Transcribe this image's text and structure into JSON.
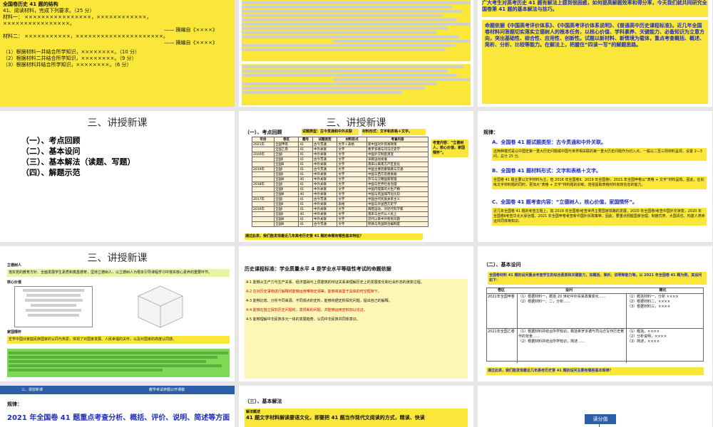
{
  "slides": {
    "s1": {
      "lines": [
        "全国卷历史 41 题的结构",
        "41、阅读材料，完成下列要求。（25 分）",
        "材料一：  ××××××××××××××××，××××××××××××，",
        "××××××××××××××××。",
        "—— 摘编自《××××》",
        "材料二：  ×××××××××××，×××××××××××××××××××××。",
        "—— 摘编自《××××》"
      ],
      "questions": [
        "（1）根据材料一并结合所学知识，××××××××。（10 分）",
        "（2）根据材料二并结合所学知识，××××××××。（9 分）",
        "（3）根据材料并结合所学知识，××××××××。（6 分）"
      ]
    },
    "s3": {
      "intro": "广大考生对高考历史 41 题有解法上感到很困惑，如何提高解题效率和得分率，今天我们就共同研究全国卷第 41 题的基本解法与技巧。",
      "body": "命题依据《中国高考评价体系》、《中国高考评价体系说明》、《普通高中历史课程标准》。近几年全国卷材料问答题切实落实立德树人的根本任务，以核心价值、学科素养、关键能力、必备知识为立意方向，突出基础性、综合性、应用性、创新性。试题以新材料、新情境为载体，重点考查概括、概述、简析、分析、比较等能力。在解法上，把握住“四读一写”的解题思路。"
    },
    "s4": {
      "title": "三、讲授新课",
      "items": [
        "（一）、考点回顾",
        "（二）、基本设问",
        "（三）、基本解法（读题、写题）",
        "（四）、解题示范"
      ]
    },
    "s5": {
      "title": "三、讲授新课",
      "heading": "（一）、考点回顾",
      "tag1": "试题类型：古今贯通和中外关联",
      "tag2": "材料形式：文字和表格＋文字。",
      "side": "考查内容：“立德树人，核心价值，家国情怀”。",
      "headers": [
        "年份",
        "卷区",
        "题号",
        "试题类型",
        "材料形式",
        "考查内容"
      ],
      "rows": [
        [
          "2021年",
          "全国甲卷",
          "41",
          "古今贯通",
          "文字＋表格",
          "新中国对外贸易政策"
        ],
        [
          "",
          "全国乙卷",
          "41",
          "中外关联",
          "文字",
          "希罗多德与司马迁史学"
        ],
        [
          "2020年",
          "全国Ⅰ",
          "41",
          "中外关联",
          "文字",
          "中国外交制度演变"
        ],
        [
          "",
          "全国Ⅱ",
          "41",
          "古今贯通",
          "文字",
          "早教运动发展"
        ],
        [
          "",
          "全国Ⅲ",
          "41",
          "中外关联",
          "文字",
          "南宋以来南方产区变化"
        ],
        [
          "2019年",
          "全国Ⅰ",
          "41",
          "古今贯通",
          "文字",
          "中国主要因素铁路与交通"
        ],
        [
          "",
          "全国Ⅱ",
          "41",
          "中外关联",
          "文字",
          "中国与西方思想发展"
        ],
        [
          "",
          "全国Ⅲ",
          "40",
          "中外关联",
          "文字",
          "罗马与汉朝国家管理"
        ],
        [
          "2018年",
          "全国Ⅰ",
          "41",
          "中外关联",
          "文字",
          "中国与世界社会治理"
        ],
        [
          "",
          "全国Ⅱ",
          "41",
          "中外关联",
          "文字",
          "中国内夜属的大生产精"
        ],
        [
          "",
          "全国Ⅲ",
          "40",
          "中外关联",
          "文字",
          "中国与英国城市化比较"
        ],
        [
          "2017年",
          "全国Ⅰ",
          "41",
          "古今贯通",
          "文字",
          "中国古代民族关系主义"
        ],
        [
          "",
          "全国Ⅱ",
          "41",
          "中外关联",
          "表格",
          "中国与外国西方史学"
        ],
        [
          "2016年",
          "全国Ⅰ",
          "41",
          "中外关联",
          "文字",
          "辉煌运动，对近代科学家"
        ],
        [
          "",
          "全国Ⅱ",
          "40",
          "中外关联",
          "文字",
          "南宋与古代以人民上"
        ],
        [
          "",
          "全国Ⅲ",
          "41",
          "中外关联",
          "文字",
          "近代以来中外移民问题"
        ],
        [
          "",
          "全国Ⅲ",
          "41",
          "古今贯通",
          "文字",
          "明清与英国政治编制度"
        ]
      ],
      "footer": "通过此表，我们能发现最近几年高考历史第 41 题的命题有哪些基本特征？"
    },
    "s6": {
      "heading": "规律：",
      "a": "A、全国卷 41 题试题类型：古今贯通和中外关联。",
      "a_note": "这两种模式是以中国史第一重大历史问题或中国与世界相关联的第一重大历史问题作为切入点，一般以二至三则材料呈现，设置 2—3 问，总分 25 分。",
      "b": "B、全国卷 41 题材料形式：文字和表格＋文字。",
      "b_note": "全国卷 41 题主要以文字材料为主，但 2016 年全国卷Ⅱ、2019 年全国卷Ⅰ、2021 年全国甲卷以“表格 + 文字”材料呈现。因此，在训练文字材料题的同时，更加大“表格 + 文字”材料题的训练，增强提取表格材料有效信息的能力。",
      "c": "C、全国卷 41 题考查内容：“立德树人，核心价值，家国情怀”。",
      "c_note": "近几年全国卷 41 题的考查主题上，如 2019 年全国卷Ⅰ考查世界主要国家铁路的发展，2020 年全国卷Ⅰ考查中国外交演变，2020 年全国卷Ⅱ考查华北大豪治理，2021 年全国甲卷考查新中国外贸政策等，因此，要重点把握国家治理、制度优势、大国责任、构建人类命运共同体等知识。"
    },
    "s7": {
      "title": "三、讲授新课",
      "lide": "立德树人",
      "lide_note": "落实党的教育方针、全面发展学生素质和奠基德育，坚持立德树人，以立德树人为根本引导课程学习中落实核心素养的重要环节。",
      "hexin": "核心价值",
      "jiaguo": "家国情怀",
      "jiaguo_note": "史学中国对家庭民族国家的认同与热爱，体现了对国家发展、人民幸福的关怀，以及对国家的高度认同感。"
    },
    "s8": {
      "heading": "历史课程标准：学业质量水平 4 是学业水平等级性考试的命题依据",
      "items": [
        "4-1 能够从生产力与生产关系、经济基础与上层建筑的辩证关系来理解历史上的发展变化和社会形态的演变过程。",
        "4-2 在对历史事物进行解释时能够运用唯物史观等，能够将其置于具体的时空框架下。",
        "4-3 能够比较、分析不同来源、不同观点的史料，能够依据史料探究问题，提出自己的解释。",
        "4-4 能够在独立探究历史问题时，发现新的问题，并能够运用史料加以论证。",
        "4-5 能够理解中华民族多元一体的发展趋势，认同中华民族共同体意识。"
      ]
    },
    "s9": {
      "heading": "（二）、基本设问",
      "note": "全国卷材料 41 题的设问重点考查学生的综合素质和关键能力，如概括、简析、说明等能力等。以 2021 年全国卷 41 题为例，其设问如下：",
      "col1": "卷区",
      "col2": "设问",
      "col3": "题化",
      "r1_label": "2021年全国甲卷",
      "r2_label": "2021年全国乙卷",
      "r1_q": [
        "（1）根据材料一，概括 20 世纪中外贸易政策变化……",
        "（2）根据材料一、二，分析……"
      ],
      "r1_a": [
        "（1）概括材料一，分析 ××××",
        "（2）根据材料二，××××",
        "（3）根据材料三，××××"
      ],
      "r2_q": [
        "（1）根据材料并结合所学知识，概括希罗多德与司马迁写作历史著作的背景……",
        "（2）根据材料并结合所学知识，简述……"
      ],
      "r2_a": [
        "（1）概括，××××",
        "（2）分析说明，××××",
        "（3）简述，××××"
      ],
      "footer": "通过此表，我们能发现最近几年高考历史第 41 题的设问主要有哪些基本规律？"
    },
    "s10": {
      "header": "三、讲授新课",
      "header_right": "教学考试命题公开课稿",
      "heading": "规律：",
      "text": "2021 年全国卷 41 题重点考查分析、概括、评价、说明、简述等方面"
    },
    "s11": {
      "heading": "（三）、基本解法",
      "sub": "解法概述",
      "text": "41 题文字材料解读要语文化，即要把 41 题当作现代文阅读的方式，精读、快读"
    },
    "s12": {
      "label": "读分值"
    }
  }
}
